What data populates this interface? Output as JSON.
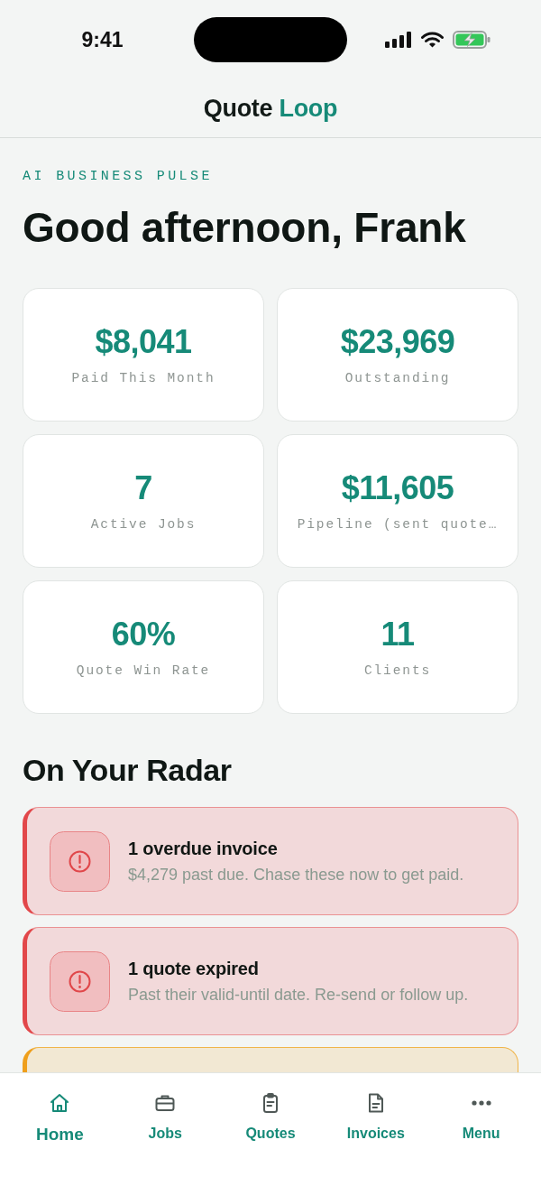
{
  "status_bar": {
    "time": "9:41"
  },
  "header": {
    "title": "Quote",
    "title_accent": "Loop"
  },
  "pulse": {
    "eyebrow": "AI BUSINESS PULSE",
    "greeting": "Good afternoon, Frank"
  },
  "metrics": [
    {
      "value": "$8,041",
      "label": "Paid This Month"
    },
    {
      "value": "$23,969",
      "label": "Outstanding"
    },
    {
      "value": "7",
      "label": "Active Jobs"
    },
    {
      "value": "$11,605",
      "label": "Pipeline (sent quote…"
    },
    {
      "value": "60%",
      "label": "Quote Win Rate"
    },
    {
      "value": "11",
      "label": "Clients"
    }
  ],
  "radar": {
    "title": "On Your Radar",
    "alerts": [
      {
        "kind": "danger",
        "title": "1 overdue invoice",
        "description": "$4,279 past due. Chase these now to get paid."
      },
      {
        "kind": "danger",
        "title": "1 quote expired",
        "description": "Past their valid-until date. Re-send or follow up."
      },
      {
        "kind": "warning"
      }
    ]
  },
  "nav": {
    "tabs": [
      {
        "label": "Home",
        "selected": true
      },
      {
        "label": "Jobs",
        "selected": false
      },
      {
        "label": "Quotes",
        "selected": false
      },
      {
        "label": "Invoices",
        "selected": false
      },
      {
        "label": "Menu",
        "selected": false
      }
    ]
  }
}
